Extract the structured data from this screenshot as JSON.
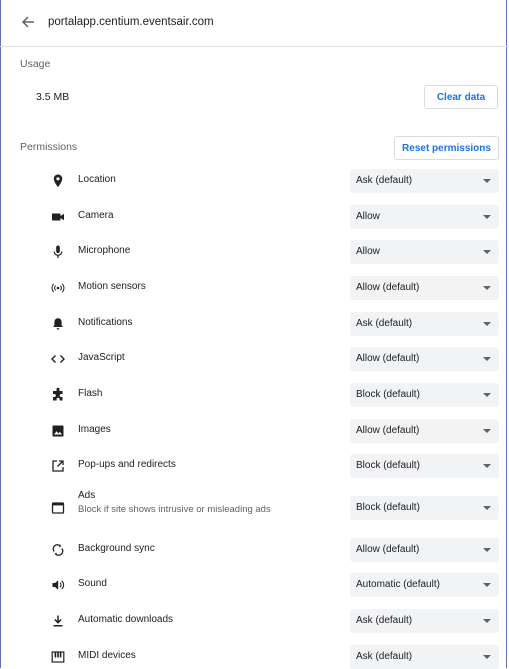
{
  "header": {
    "site": "portalapp.centium.eventsair.com"
  },
  "usage": {
    "title": "Usage",
    "value": "3.5 MB",
    "clear_label": "Clear data"
  },
  "permissions": {
    "title": "Permissions",
    "reset_label": "Reset permissions",
    "items": [
      {
        "label": "Location",
        "value": "Ask (default)",
        "icon": "location-icon"
      },
      {
        "label": "Camera",
        "value": "Allow",
        "icon": "camera-icon"
      },
      {
        "label": "Microphone",
        "value": "Allow",
        "icon": "microphone-icon"
      },
      {
        "label": "Motion sensors",
        "value": "Allow (default)",
        "icon": "motion-sensors-icon"
      },
      {
        "label": "Notifications",
        "value": "Ask (default)",
        "icon": "bell-icon"
      },
      {
        "label": "JavaScript",
        "value": "Allow (default)",
        "icon": "code-icon"
      },
      {
        "label": "Flash",
        "value": "Block (default)",
        "icon": "puzzle-icon"
      },
      {
        "label": "Images",
        "value": "Allow (default)",
        "icon": "image-icon"
      },
      {
        "label": "Pop-ups and redirects",
        "value": "Block (default)",
        "icon": "open-in-new-icon"
      },
      {
        "label": "Ads",
        "sub": "Block if site shows intrusive or misleading ads",
        "value": "Block (default)",
        "icon": "ads-icon"
      },
      {
        "label": "Background sync",
        "value": "Allow (default)",
        "icon": "sync-icon"
      },
      {
        "label": "Sound",
        "value": "Automatic (default)",
        "icon": "speaker-icon"
      },
      {
        "label": "Automatic downloads",
        "value": "Ask (default)",
        "icon": "download-icon"
      },
      {
        "label": "MIDI devices",
        "value": "Ask (default)",
        "icon": "piano-icon"
      }
    ]
  }
}
